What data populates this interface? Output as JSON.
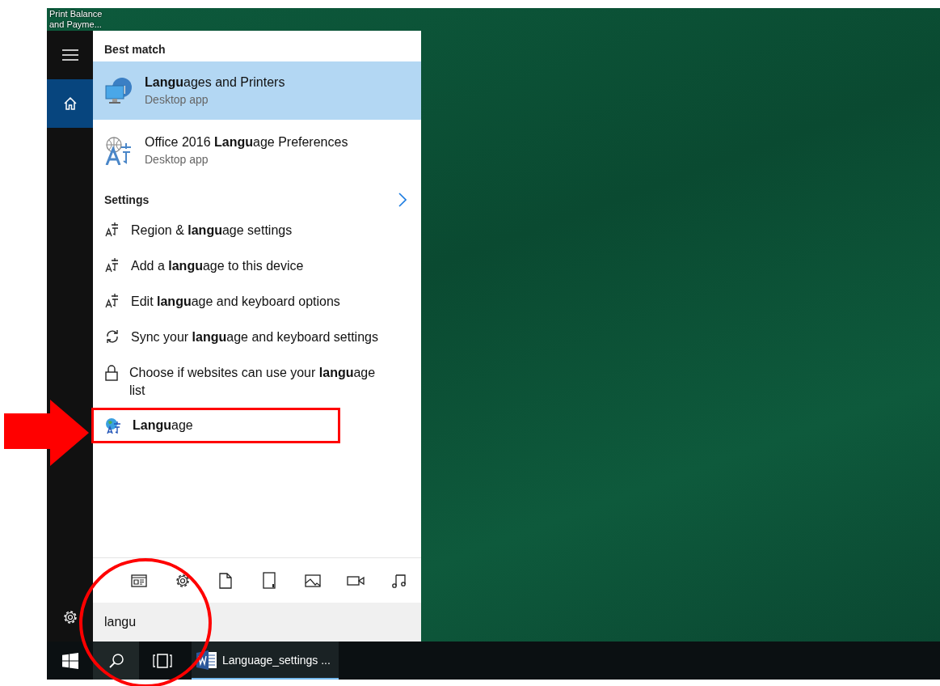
{
  "desktop": {
    "icon_label": "Print Balance and Payme..."
  },
  "sidebar": {
    "items": [
      {
        "kind": "menu",
        "selected": false
      },
      {
        "kind": "home",
        "selected": true
      },
      {
        "kind": "settings",
        "selected": false
      }
    ]
  },
  "results": {
    "best_match_heading": "Best match",
    "apps": [
      {
        "name": "**Langu**ages and Printers",
        "subtitle": "Desktop app",
        "kind": "monitor-globe",
        "selected": true
      },
      {
        "name": "Office 2016 **Langu**age Preferences",
        "subtitle": "Desktop app",
        "kind": "language",
        "selected": false
      }
    ],
    "settings_heading": "Settings",
    "settings": [
      {
        "text": "Region & **langu**age settings",
        "kind": "language",
        "outlined": false
      },
      {
        "text": "Add a **langu**age to this device",
        "kind": "language",
        "outlined": false
      },
      {
        "text": "Edit **langu**age and keyboard options",
        "kind": "language",
        "outlined": false
      },
      {
        "text": "Sync your **langu**age and keyboard settings",
        "kind": "sync",
        "outlined": false
      },
      {
        "text": "Choose if websites can use your **langu**age list",
        "kind": "lock",
        "outlined": false
      },
      {
        "text": "**Langu**age",
        "kind": "globe-language",
        "outlined": true
      }
    ]
  },
  "filters": [
    {
      "kind": "apps"
    },
    {
      "kind": "settings"
    },
    {
      "kind": "documents"
    },
    {
      "kind": "folders"
    },
    {
      "kind": "photos"
    },
    {
      "kind": "videos"
    },
    {
      "kind": "music"
    }
  ],
  "search_box": {
    "value": "langu"
  },
  "taskbar": {
    "buttons": [
      {
        "kind": "start",
        "selected": false
      },
      {
        "kind": "search",
        "selected": true
      },
      {
        "kind": "task-view",
        "selected": false
      }
    ],
    "apps": [
      {
        "label": "Language_settings ...",
        "active": true
      }
    ]
  },
  "callouts": {
    "arrow": true,
    "circle": true
  }
}
